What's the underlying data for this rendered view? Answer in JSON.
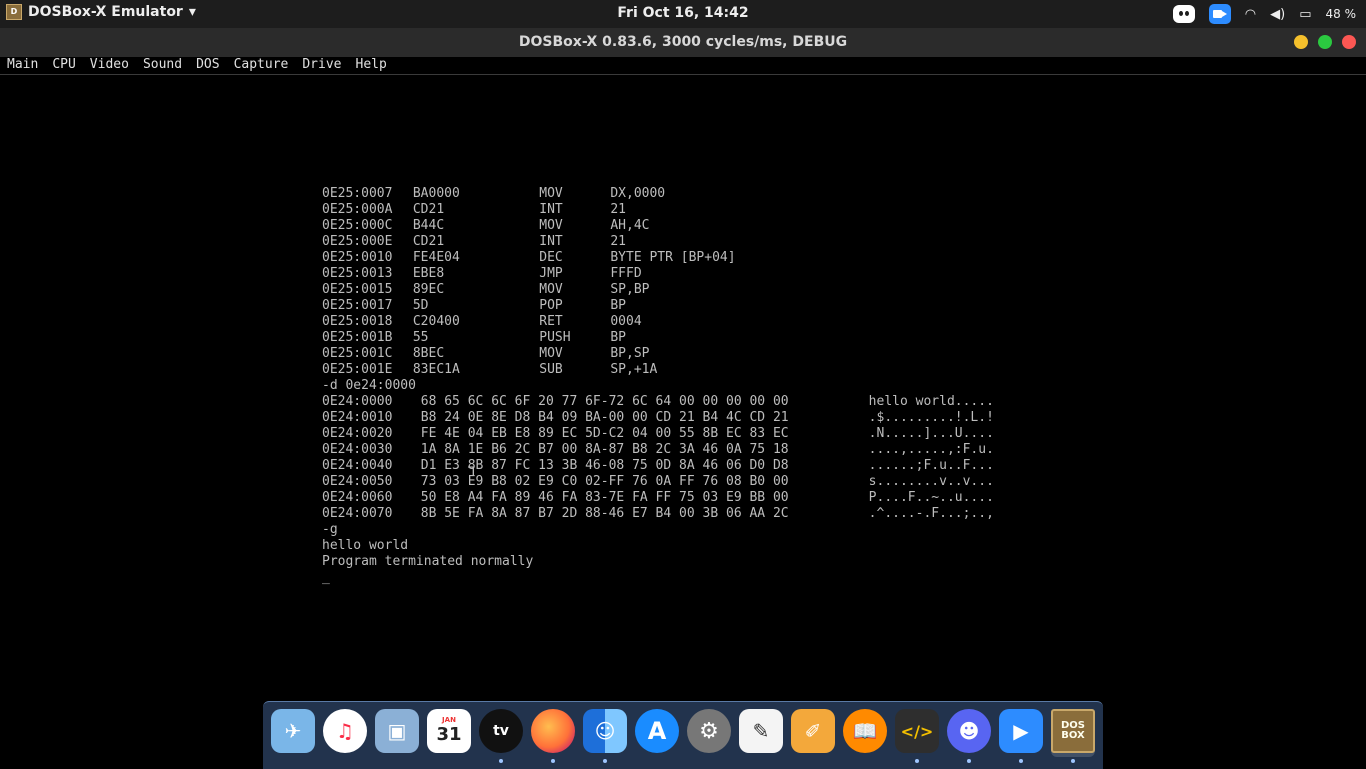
{
  "topbar": {
    "app_name": "DOSBox-X Emulator",
    "app_menu_arrow": "▾",
    "clock": "Fri Oct 16, 14:42",
    "battery": "48 %",
    "wifi_glyph": "◠",
    "volume_glyph": "◀)",
    "battery_glyph": "▭"
  },
  "window": {
    "title": "DOSBox-X 0.83.6, 3000 cycles/ms, DEBUG"
  },
  "menubar": {
    "items": [
      "Main",
      "CPU",
      "Video",
      "Sound",
      "DOS",
      "Capture",
      "Drive",
      "Help"
    ]
  },
  "console": {
    "disasm": [
      {
        "addr": "0E25:0007",
        "bytes": "BA0000",
        "op": "MOV",
        "args": "DX,0000"
      },
      {
        "addr": "0E25:000A",
        "bytes": "CD21",
        "op": "INT",
        "args": "21"
      },
      {
        "addr": "0E25:000C",
        "bytes": "B44C",
        "op": "MOV",
        "args": "AH,4C"
      },
      {
        "addr": "0E25:000E",
        "bytes": "CD21",
        "op": "INT",
        "args": "21"
      },
      {
        "addr": "0E25:0010",
        "bytes": "FE4E04",
        "op": "DEC",
        "args": "BYTE PTR [BP+04]"
      },
      {
        "addr": "0E25:0013",
        "bytes": "EBE8",
        "op": "JMP",
        "args": "FFFD"
      },
      {
        "addr": "0E25:0015",
        "bytes": "89EC",
        "op": "MOV",
        "args": "SP,BP"
      },
      {
        "addr": "0E25:0017",
        "bytes": "5D",
        "op": "POP",
        "args": "BP"
      },
      {
        "addr": "0E25:0018",
        "bytes": "C20400",
        "op": "RET",
        "args": "0004"
      },
      {
        "addr": "0E25:001B",
        "bytes": "55",
        "op": "PUSH",
        "args": "BP"
      },
      {
        "addr": "0E25:001C",
        "bytes": "8BEC",
        "op": "MOV",
        "args": "BP,SP"
      },
      {
        "addr": "0E25:001E",
        "bytes": "83EC1A",
        "op": "SUB",
        "args": "SP,+1A"
      }
    ],
    "dump_command": "-d 0e24:0000",
    "dump": [
      {
        "addr": "0E24:0000",
        "hex": "68 65 6C 6C 6F 20 77 6F-72 6C 64 00 00 00 00 00",
        "ascii": "hello world....."
      },
      {
        "addr": "0E24:0010",
        "hex": "B8 24 0E 8E D8 B4 09 BA-00 00 CD 21 B4 4C CD 21",
        "ascii": ".$.........!.L.!"
      },
      {
        "addr": "0E24:0020",
        "hex": "FE 4E 04 EB E8 89 EC 5D-C2 04 00 55 8B EC 83 EC",
        "ascii": ".N.....]...U...."
      },
      {
        "addr": "0E24:0030",
        "hex": "1A 8A 1E B6 2C B7 00 8A-87 B8 2C 3A 46 0A 75 18",
        "ascii": "....,.....,:F.u."
      },
      {
        "addr": "0E24:0040",
        "hex": "D1 E3 8B 87 FC 13 3B 46-08 75 0D 8A 46 06 D0 D8",
        "ascii": "......;F.u..F..."
      },
      {
        "addr": "0E24:0050",
        "hex": "73 03 E9 B8 02 E9 C0 02-FF 76 0A FF 76 08 B0 00",
        "ascii": "s........v..v..."
      },
      {
        "addr": "0E24:0060",
        "hex": "50 E8 A4 FA 89 46 FA 83-7E FA FF 75 03 E9 BB 00",
        "ascii": "P....F..~..u...."
      },
      {
        "addr": "0E24:0070",
        "hex": "8B 5E FA 8A 87 B7 2D 88-46 E7 B4 00 3B 06 AA 2C",
        "ascii": ".^....-.F...;..,"
      }
    ],
    "go_command": "-g",
    "output_1": "hello world",
    "output_2": "Program terminated normally",
    "prompt": "_",
    "mouse_cursor": "Ꞁ"
  },
  "dock": {
    "items": [
      {
        "name": "mail",
        "glyph": "✈"
      },
      {
        "name": "music",
        "glyph": "♫"
      },
      {
        "name": "preview",
        "glyph": "▣"
      },
      {
        "name": "calendar",
        "month": "JAN",
        "day": "31"
      },
      {
        "name": "apple-tv",
        "glyph": "tv"
      },
      {
        "name": "firefox",
        "glyph": ""
      },
      {
        "name": "finder",
        "glyph": "☺"
      },
      {
        "name": "app-store",
        "glyph": "A"
      },
      {
        "name": "system-preferences",
        "glyph": "⚙"
      },
      {
        "name": "textedit",
        "glyph": "✎"
      },
      {
        "name": "pages",
        "glyph": "✐"
      },
      {
        "name": "books",
        "glyph": "📖"
      },
      {
        "name": "script-editor",
        "glyph": "</>"
      },
      {
        "name": "discord",
        "glyph": "☻"
      },
      {
        "name": "zoom",
        "glyph": "▶"
      },
      {
        "name": "dosbox",
        "line1": "DOS",
        "line2": "BOX"
      }
    ]
  },
  "colors": {
    "console_text": "#bdbdbd",
    "topbar_bg": "#1d1d1d",
    "titlebar_bg": "#2b2b2b",
    "dock_bg": "#283c5a"
  }
}
